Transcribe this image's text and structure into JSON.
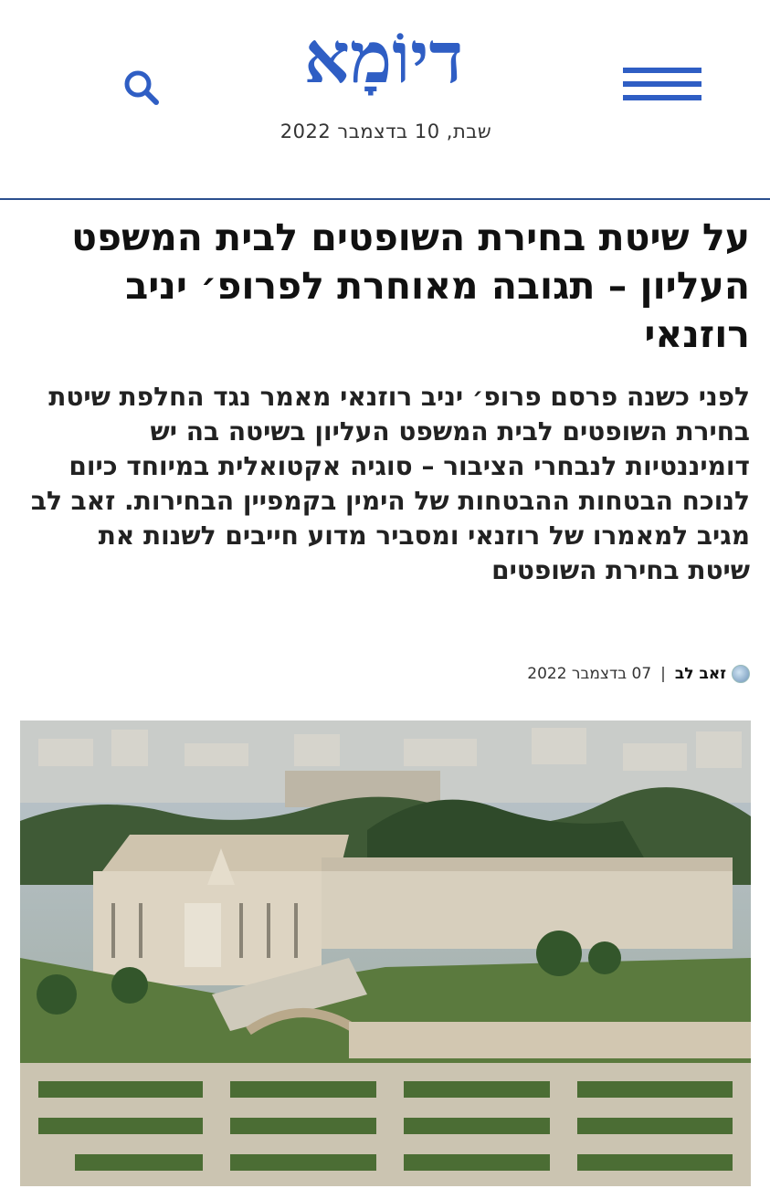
{
  "header": {
    "logo_text": "דיוֹמָא",
    "date": "שבת, 10 בדצמבר 2022",
    "menu_icon": "hamburger-menu-icon",
    "search_icon": "search-icon",
    "brand_color": "#2f5ec4"
  },
  "article": {
    "title": "על שיטת בחירת השופטים לבית המשפט העליון – תגובה מאוחרת לפרופ׳ יניב רוזנאי",
    "lead": "לפני כשנה פרסם פרופ׳ יניב רוזנאי מאמר נגד החלפת שיטת בחירת השופטים לבית המשפט העליון בשיטה בה יש דומיננטיות לנבחרי הציבור – סוגיה אקטואלית במיוחד כיום לנוכח הבטחות ההבטחות של הימין בקמפיין הבחירות. זאב לב מגיב למאמרו של רוזנאי ומסביר מדוע חייבים לשנות את שיטת בחירת השופטים",
    "author": "זאב לב",
    "separator": "|",
    "published": "07 בדצמבר 2022",
    "photo_description_icon": "supreme-court-photo"
  }
}
